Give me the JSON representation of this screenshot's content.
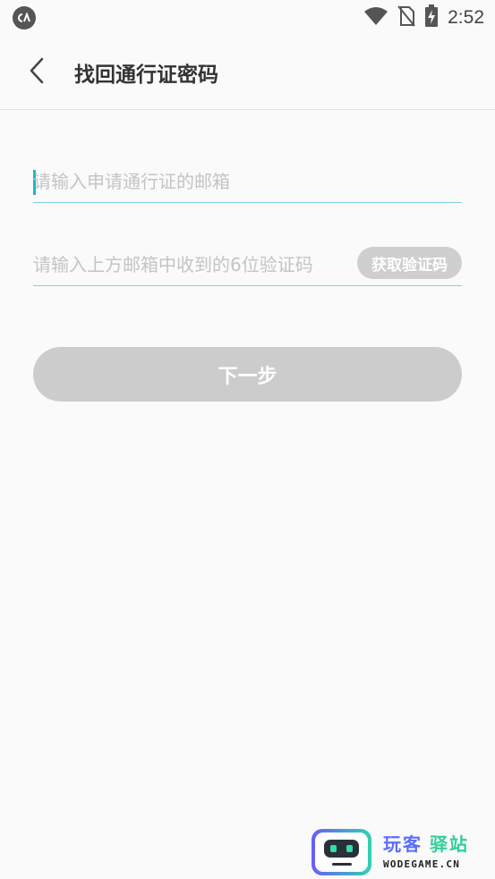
{
  "status_bar": {
    "time": "2:52",
    "icons": [
      "app-notification-icon",
      "wifi-icon",
      "no-sim-icon",
      "battery-charging-icon"
    ]
  },
  "header": {
    "title": "找回通行证密码",
    "back_icon": "chevron-left-icon"
  },
  "form": {
    "email_placeholder": "请输入申请通行证的邮箱",
    "email_value": "",
    "code_placeholder": "请输入上方邮箱中收到的6位验证码",
    "code_value": "",
    "get_code_label": "获取验证码",
    "next_label": "下一步"
  },
  "colors": {
    "accent": "#1fb6c8",
    "underline": "#7fd3db",
    "disabled_button": "#cccccc"
  },
  "watermark": {
    "cn_part1": "玩客",
    "cn_part2": "驿站",
    "en": "WODEGAME.CN"
  }
}
